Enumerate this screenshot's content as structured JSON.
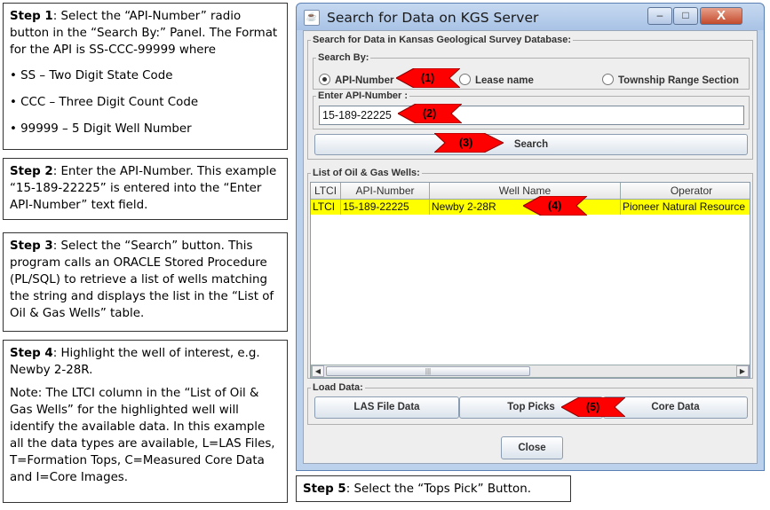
{
  "notes": {
    "step1": {
      "label": "Step 1",
      "text": ": Select the “API-Number” radio button in the “Search By:” Panel.  The Format for the API is SS-CCC-99999 where",
      "bullets": [
        "• SS – Two  Digit State Code",
        "• CCC – Three Digit Count Code",
        "• 99999 – 5 Digit Well Number"
      ]
    },
    "step2": {
      "label": "Step 2",
      "text": ": Enter the API-Number. This example “15-189-22225” is entered into the “Enter API-Number” text field."
    },
    "step3": {
      "label": "Step 3",
      "text": ": Select the “Search” button.  This program calls an ORACLE Stored Procedure (PL/SQL) to retrieve a list of wells matching the string and displays the list in the “List of Oil & Gas Wells” table."
    },
    "step4": {
      "label": "Step 4",
      "text": ": Highlight the well of interest, e.g. Newby 2-28R.",
      "note": "Note: The LTCI column in the “List of Oil & Gas Wells” for the highlighted well will identify the available data. In this example all the data types are available, L=LAS Files, T=Formation Tops, C=Measured Core Data and I=Core Images."
    },
    "step5": {
      "label": "Step 5",
      "text": ": Select the “Tops Pick” Button."
    }
  },
  "window": {
    "title": "Search for Data on KGS Server",
    "app_icon": "java-icon",
    "minimize": "–",
    "maximize": "□",
    "close": "X",
    "db_group": "Search for Data in Kansas Geological Survey Database:",
    "search_by": {
      "label": "Search By:",
      "options": [
        {
          "label": "API-Number",
          "selected": true
        },
        {
          "label": "Lease name",
          "selected": false
        },
        {
          "label": "Township Range Section",
          "selected": false
        }
      ]
    },
    "api_group": "Enter API-Number :",
    "api_value": "15-189-22225",
    "search_button": "Search",
    "list_group": "List of Oil & Gas Wells:",
    "table": {
      "columns": [
        "LTCI",
        "API-Number",
        "Well Name",
        "Operator"
      ],
      "rows": [
        [
          "LTCI",
          "15-189-22225",
          "Newby 2-28R",
          "Pioneer Natural Resource"
        ]
      ]
    },
    "scroll": {
      "left": "◀",
      "right": "▶",
      "grip": "|||"
    },
    "load_group": "Load Data:",
    "load_buttons": [
      "LAS File Data",
      "Top Picks",
      "Core Data"
    ],
    "close_button": "Close"
  },
  "markers": [
    "(1)",
    "(2)",
    "(3)",
    "(4)",
    "(5)"
  ],
  "colors": {
    "marker_red": "#ff0000",
    "highlight_row": "#ffff00",
    "title_bar": "#bcd1ec"
  }
}
